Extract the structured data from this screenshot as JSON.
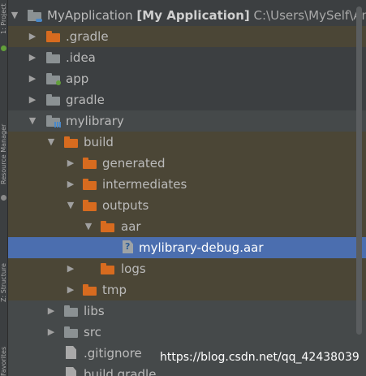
{
  "sidebar": {
    "tab_top": "1: Project",
    "tab_middle": "Resource Manager",
    "tab_lower": "Z: Structure",
    "tab_bottom": "Favorites"
  },
  "tree": {
    "rows": [
      {
        "name": "MyApplication",
        "bold": "[My Application]",
        "path": "C:\\Users\\MySelf\\AndroidStudioProjects\\MyApplication",
        "arrow": "▼",
        "icon": "module"
      },
      {
        "name": ".gradle",
        "arrow": "▶",
        "icon": "folder-orange"
      },
      {
        "name": ".idea",
        "arrow": "▶",
        "icon": "folder-gray"
      },
      {
        "name": "app",
        "arrow": "▶",
        "icon": "folder-gray-green"
      },
      {
        "name": "gradle",
        "arrow": "▶",
        "icon": "folder-gray"
      },
      {
        "name": "mylibrary",
        "arrow": "▼",
        "icon": "folder-gray-chart"
      },
      {
        "name": "build",
        "arrow": "▼",
        "icon": "folder-orange"
      },
      {
        "name": "generated",
        "arrow": "▶",
        "icon": "folder-orange"
      },
      {
        "name": "intermediates",
        "arrow": "▶",
        "icon": "folder-orange"
      },
      {
        "name": "outputs",
        "arrow": "▼",
        "icon": "folder-orange"
      },
      {
        "name": "aar",
        "arrow": "▼",
        "icon": "folder-orange"
      },
      {
        "name": "mylibrary-debug.aar",
        "arrow": "",
        "icon": "file-unknown"
      },
      {
        "name": "logs",
        "arrow": "▶",
        "icon": "folder-orange"
      },
      {
        "name": "tmp",
        "arrow": "▶",
        "icon": "folder-orange"
      },
      {
        "name": "libs",
        "arrow": "▶",
        "icon": "folder-gray"
      },
      {
        "name": "src",
        "arrow": "▶",
        "icon": "folder-gray"
      },
      {
        "name": ".gitignore",
        "arrow": "",
        "icon": "file-generic"
      },
      {
        "name": "build.gradle",
        "arrow": "",
        "icon": "file-generic"
      }
    ]
  },
  "watermark": "https://blog.csdn.net/qq_42438039",
  "colors": {
    "background": "#3c3f41",
    "selection": "#4b6eaf",
    "folder_orange": "#d76b1f",
    "folder_gray": "#8b9193"
  }
}
